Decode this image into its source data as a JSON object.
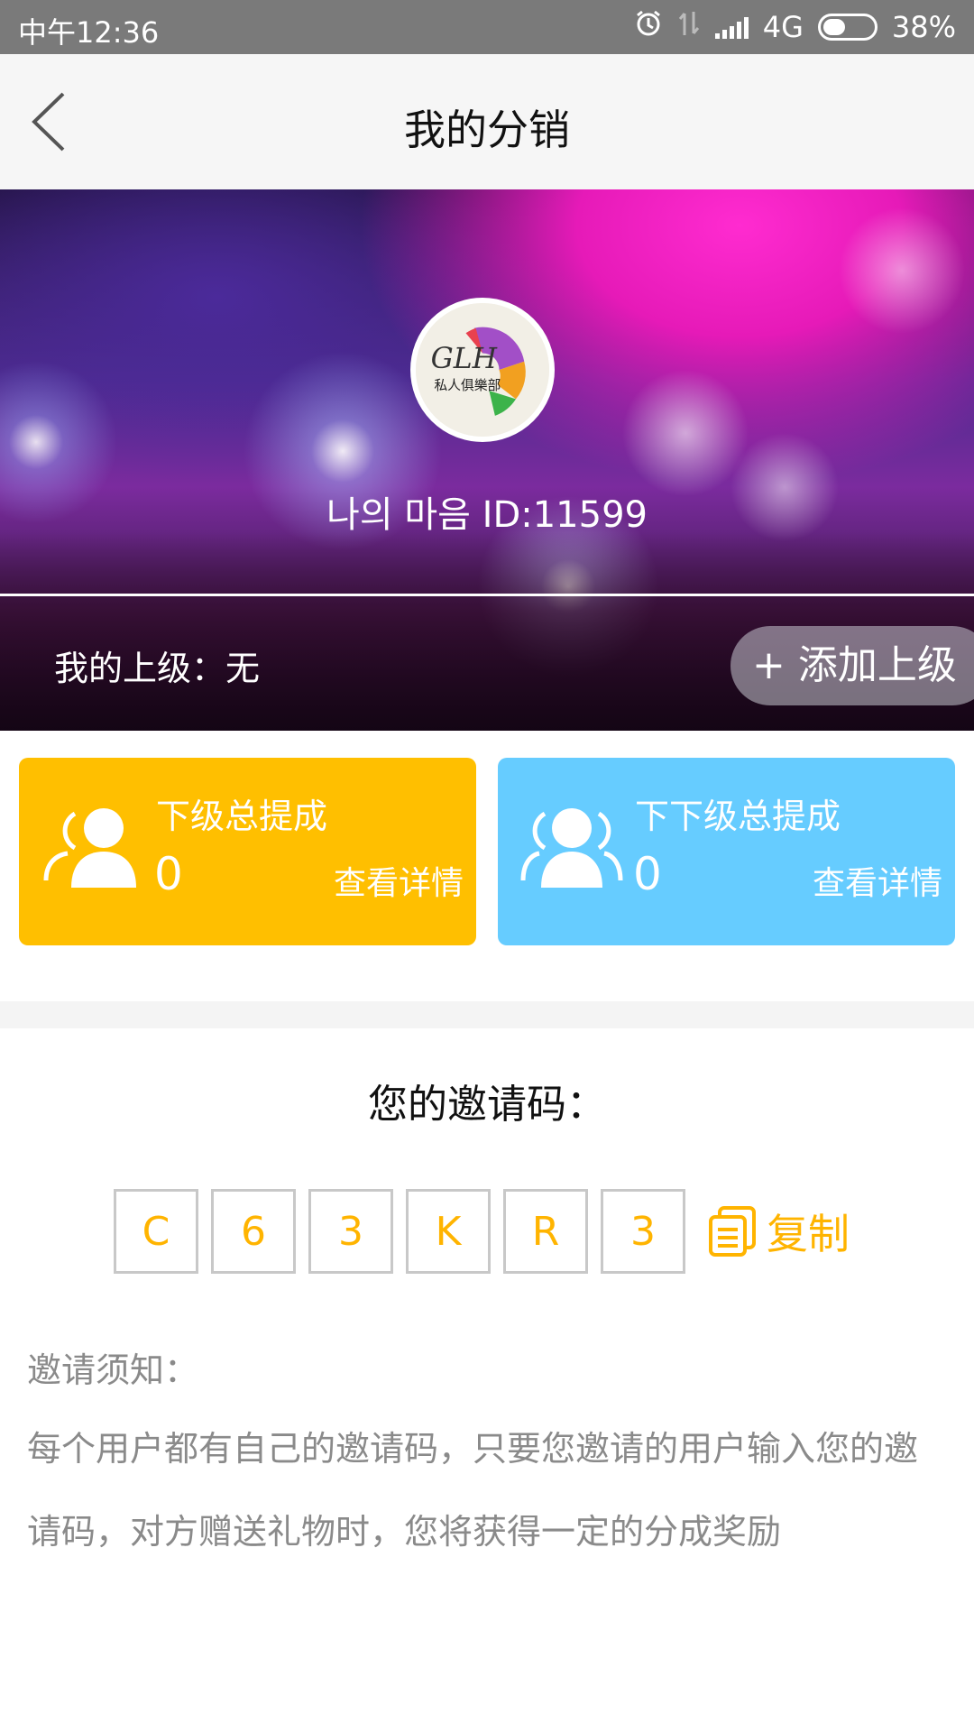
{
  "status_bar": {
    "time": "中午12:36",
    "network": "4G",
    "battery": "38%",
    "icons": [
      "alarm-icon",
      "data-transfer-icon",
      "signal-icon",
      "battery-icon"
    ]
  },
  "nav": {
    "title": "我的分销",
    "back_icon": "chevron-left-icon"
  },
  "profile": {
    "avatar_icon": "club-logo-avatar",
    "username_line": "나의 마음 ID:11599",
    "superior_text": "我的上级：无",
    "add_superior_label": "+ 添加上级"
  },
  "cards": [
    {
      "label": "下级总提成",
      "value": "0",
      "detail": "查看详情",
      "color": "#ffbf00",
      "icon": "users-icon"
    },
    {
      "label": "下下级总提成",
      "value": "0",
      "detail": "查看详情",
      "color": "#66ccff",
      "icon": "users-icon"
    }
  ],
  "invite": {
    "title": "您的邀请码：",
    "code": [
      "C",
      "6",
      "3",
      "K",
      "R",
      "3"
    ],
    "copy_label": "复制",
    "copy_icon": "copy-icon",
    "accent": "#ffb400"
  },
  "notice": {
    "title": "邀请须知：",
    "text": "每个用户都有自己的邀请码，只要您邀请的用户输入您的邀请码，对方赠送礼物时，您将获得一定的分成奖励"
  }
}
